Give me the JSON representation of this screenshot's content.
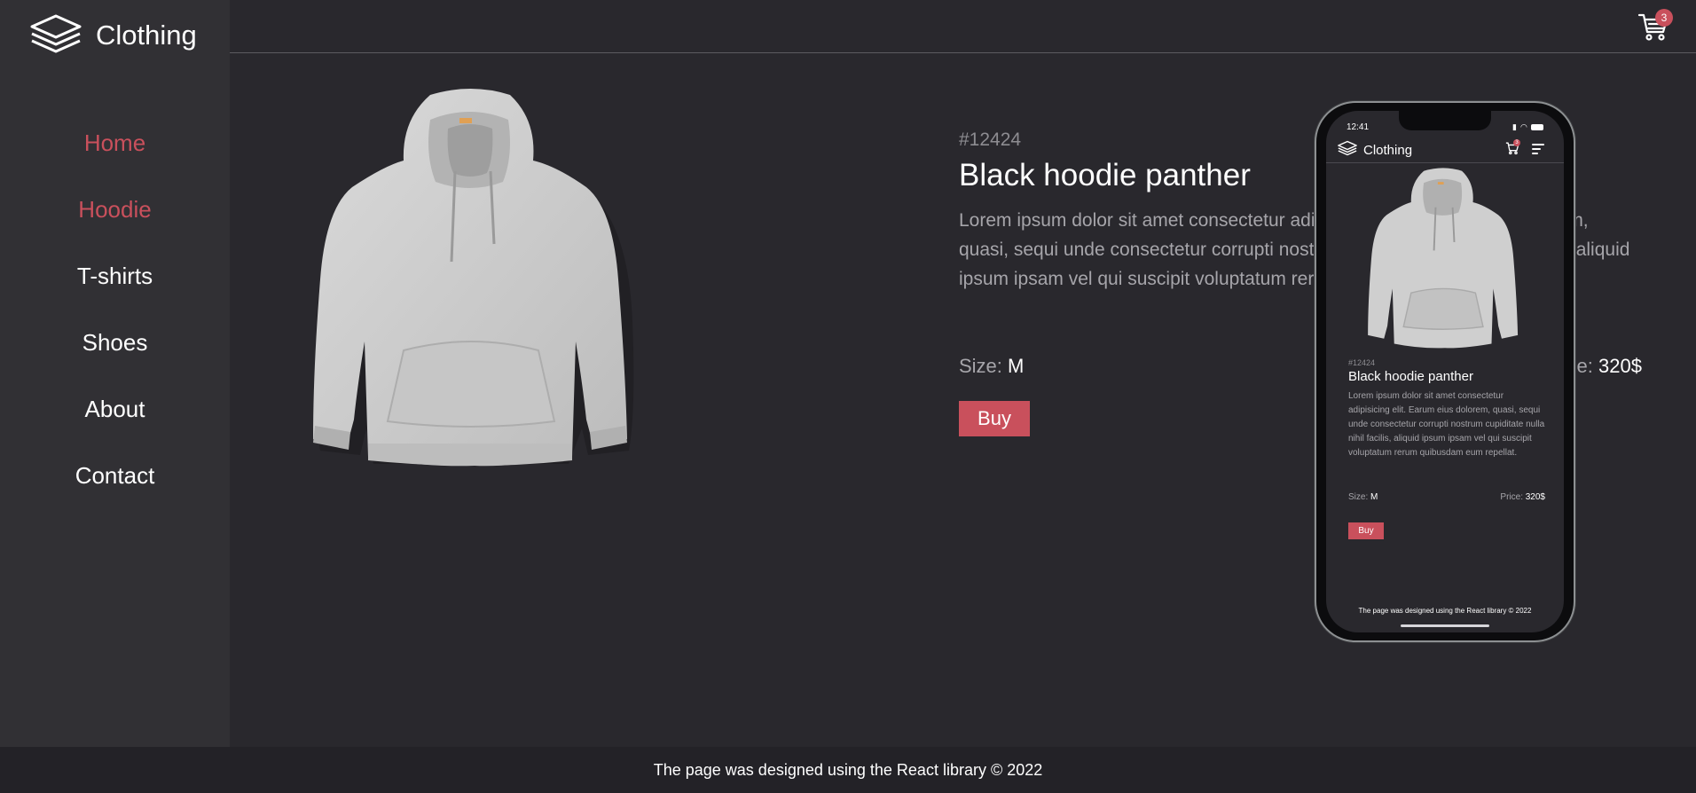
{
  "brand": {
    "name": "Clothing"
  },
  "nav": {
    "items": [
      {
        "label": "Home",
        "active": true
      },
      {
        "label": "Hoodie",
        "active": true
      },
      {
        "label": "T-shirts",
        "active": false
      },
      {
        "label": "Shoes",
        "active": false
      },
      {
        "label": "About",
        "active": false
      },
      {
        "label": "Contact",
        "active": false
      }
    ]
  },
  "cart": {
    "count": "3",
    "icon": "cart-icon"
  },
  "product": {
    "sku": "#12424",
    "title": "Black hoodie panther",
    "description": "Lorem ipsum dolor sit amet consectetur adipisicing elit. Earum eius dolorem, quasi, sequi unde consectetur corrupti nostrum cupiditate nulla nihil facilis, aliquid ipsum ipsam vel qui suscipit voluptatum rerum quibusdam eum repellat.",
    "size_label": "Size:",
    "size_value": "M",
    "price_label": "Price:",
    "price_value": "320$",
    "buy_label": "Buy",
    "image": "hoodie-image"
  },
  "mobile": {
    "time": "12:41",
    "brand": "Clothing",
    "cart_count": "3",
    "footer": "The page was designed using the React library © 2022"
  },
  "footer": {
    "text": "The page was designed using the React library © 2022"
  },
  "colors": {
    "background": "#29282d",
    "sidebar": "#313034",
    "footer": "#232227",
    "accent": "#c9505c",
    "muted_text": "#a6a5aa"
  }
}
